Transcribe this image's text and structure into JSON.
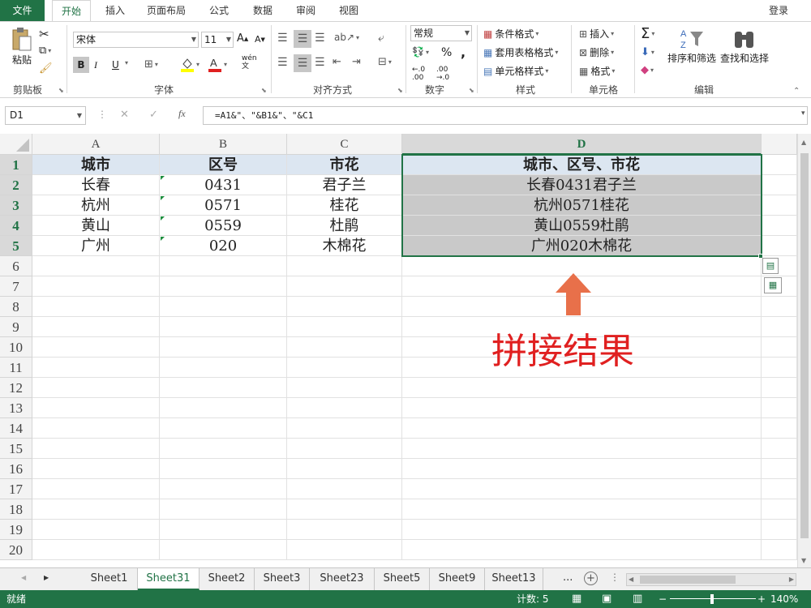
{
  "ribbon_tabs": [
    "文件",
    "开始",
    "插入",
    "页面布局",
    "公式",
    "数据",
    "审阅",
    "视图"
  ],
  "signin": "登录",
  "clipboard": {
    "paste": "粘贴",
    "label": "剪贴板"
  },
  "font": {
    "name": "宋体",
    "size": "11",
    "bold": "B",
    "italic": "I",
    "underline": "U",
    "label": "字体"
  },
  "alignment": {
    "label": "对齐方式"
  },
  "number": {
    "format": "常规",
    "percent": "%",
    "comma": ",",
    "label": "数字"
  },
  "styles": {
    "conditional": "条件格式",
    "table": "套用表格格式",
    "cell": "单元格样式",
    "label": "样式"
  },
  "cells": {
    "insert": "插入",
    "delete": "删除",
    "format": "格式",
    "label": "单元格"
  },
  "editing": {
    "sort": "排序和筛选",
    "find": "查找和选择",
    "label": "编辑"
  },
  "formula_bar": {
    "name_box": "D1",
    "fx": "fx",
    "formula": "=A1&\"、\"&B1&\"、\"&C1"
  },
  "columns": [
    "A",
    "B",
    "C",
    "D"
  ],
  "rows": [
    "1",
    "2",
    "3",
    "4",
    "5",
    "6",
    "7",
    "8",
    "9",
    "10",
    "11",
    "12",
    "13",
    "14",
    "15",
    "16",
    "17",
    "18",
    "19",
    "20"
  ],
  "table": [
    [
      "城市",
      "区号",
      "市花",
      "城市、区号、市花"
    ],
    [
      "长春",
      "0431",
      "君子兰",
      "长春0431君子兰"
    ],
    [
      "杭州",
      "0571",
      "桂花",
      "杭州0571桂花"
    ],
    [
      "黄山",
      "0559",
      "杜鹃",
      "黄山0559杜鹃"
    ],
    [
      "广州",
      "020",
      "木棉花",
      "广州020木棉花"
    ]
  ],
  "annotation": {
    "text": "拼接结果",
    "color": "#e02020",
    "arrow_color": "#e8704a"
  },
  "sheet_tabs": [
    "Sheet1",
    "Sheet31",
    "Sheet2",
    "Sheet3",
    "Sheet23",
    "Sheet5",
    "Sheet9",
    "Sheet13"
  ],
  "active_sheet": "Sheet31",
  "sheet_more": "...",
  "status": {
    "ready": "就绪",
    "count": "计数: 5",
    "zoom": "140%"
  },
  "colors": {
    "accent": "#217346",
    "header_fill": "#dce6f1",
    "selection_fill": "#c9c9c9"
  }
}
